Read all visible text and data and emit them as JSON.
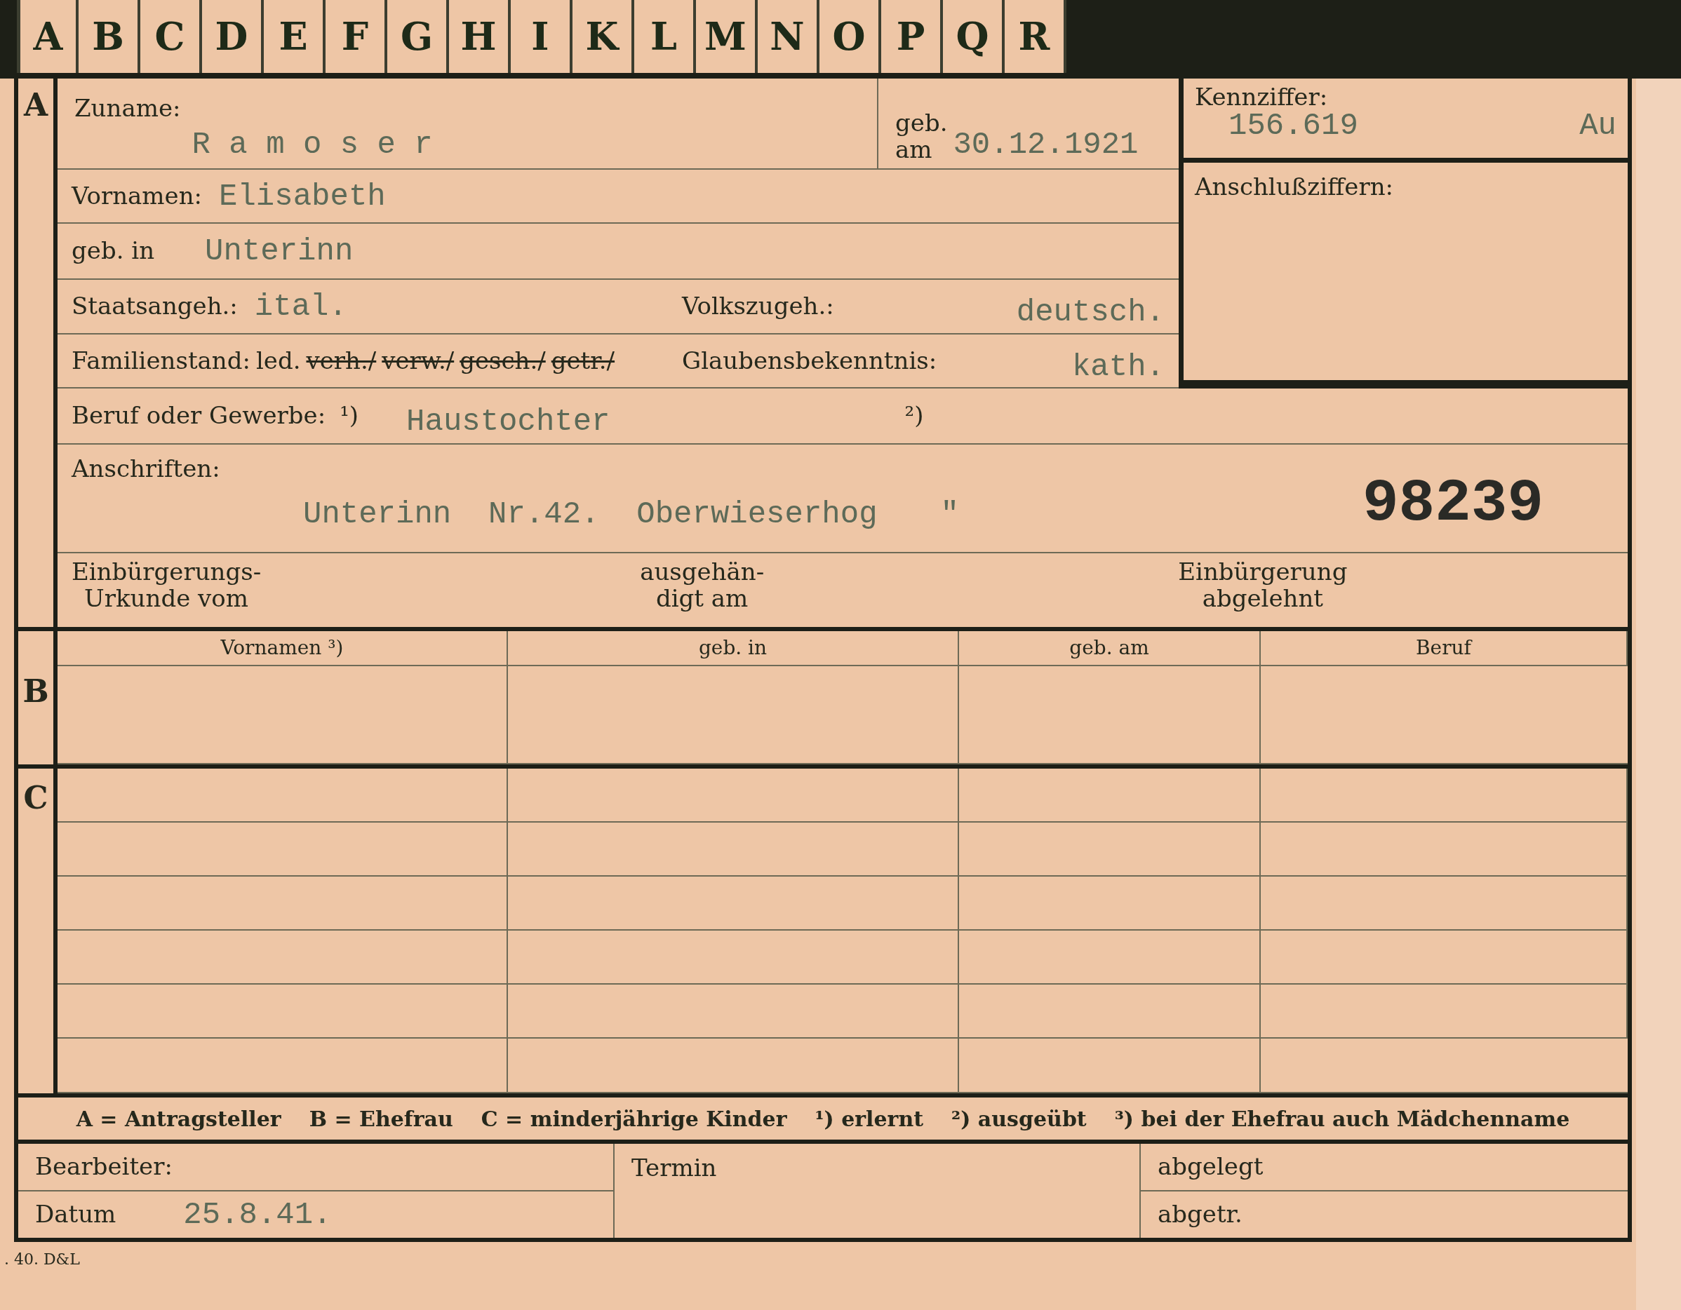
{
  "index_tabs": [
    "A",
    "B",
    "C",
    "D",
    "E",
    "F",
    "G",
    "H",
    "I",
    "K",
    "L",
    "M",
    "N",
    "O",
    "P",
    "Q",
    "R"
  ],
  "section_a": {
    "marker": "A",
    "surname": {
      "label": "Zuname:",
      "value": "R a m o s e r"
    },
    "birth_date": {
      "label_lines": [
        "geb.",
        "am"
      ],
      "value": "30.12.1921"
    },
    "reference_number": {
      "label": "Kennziffer:",
      "value": "156.619",
      "suffix": "Au"
    },
    "connection_numbers": {
      "label": "Anschlußziffern:"
    },
    "given_names": {
      "label": "Vornamen:",
      "value": "Elisabeth"
    },
    "birthplace": {
      "label": "geb. in",
      "value": "Unterinn"
    },
    "citizenship": {
      "label": "Staatsangeh.:",
      "value": "ital."
    },
    "ethnicity": {
      "label": "Volkszugeh.:",
      "value": "deutsch."
    },
    "marital_status": {
      "label": "Familienstand:",
      "options": [
        {
          "text": "led.",
          "struck": false
        },
        {
          "text": "verh./",
          "struck": true
        },
        {
          "text": "verw./",
          "struck": true
        },
        {
          "text": "gesch./",
          "struck": true
        },
        {
          "text": "getr./",
          "struck": true
        }
      ]
    },
    "religion": {
      "label": "Glaubensbekenntnis:",
      "value": "kath."
    },
    "occupation": {
      "label": "Beruf oder Gewerbe:",
      "note_learned": "¹)",
      "value": "Haustochter",
      "note_practised": "²)"
    },
    "addresses": {
      "label": "Anschriften:",
      "value": "Unterinn  Nr.42.  Oberwieserhog",
      "ditto": "\"",
      "stamp": "98239"
    },
    "naturalization": {
      "certificate_lines": [
        "Einbürgerungs-",
        "Urkunde vom"
      ],
      "handed_lines": [
        "ausgehän-",
        "digt am"
      ],
      "refused_lines": [
        "Einbürgerung",
        "abgelehnt"
      ]
    }
  },
  "section_b": {
    "marker": "B",
    "columns": [
      "Vornamen ³)",
      "geb. in",
      "geb. am",
      "Beruf"
    ]
  },
  "section_c": {
    "marker": "C"
  },
  "legend": [
    "A = Antragsteller",
    "B = Ehefrau",
    "C = minderjährige Kinder",
    "¹) erlernt",
    "²) ausgeübt",
    "³) bei der Ehefrau auch Mädchenname"
  ],
  "office": {
    "clerk_label": "Bearbeiter:",
    "date_label": "Datum",
    "date_value": "25.8.41.",
    "appointment_label": "Termin",
    "filed_label": "abgelegt",
    "removed_label": "abgetr."
  },
  "print_mark": ". 40. D&L"
}
